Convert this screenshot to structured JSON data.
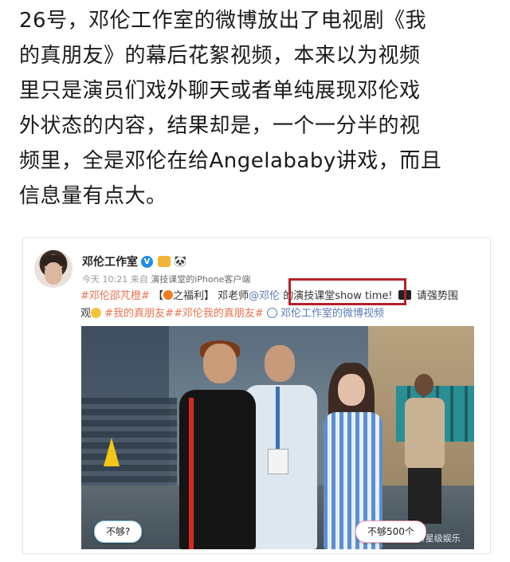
{
  "article": {
    "line1": "26号，邓伦工作室的微博放出了电视剧《我",
    "line2": "的真朋友》的幕后花絮视频，本来以为视频",
    "line3": "里只是演员们戏外聊天或者单纯展现邓伦戏",
    "line4": "外状态的内容，结果却是，一个一分半的视",
    "line5": "频里，全是邓伦在给Angelababy讲戏，而且",
    "line6": "信息量有点大。"
  },
  "post": {
    "username": "邓伦工作室",
    "verified_mark": "V",
    "panda_badge": "🐼",
    "time": "今天 10:21",
    "from_prefix": "来自",
    "source": "演技课堂的iPhone客户端",
    "text": {
      "tag1": "#邓伦邵芃橙#",
      "bracket_open": "【",
      "welfare": "之福利】",
      "teacher": "邓老师",
      "mention": "@邓伦",
      "de": " 的",
      "course": "演技课堂show time!",
      "watch": " 请强势围",
      "line2_start": "观",
      "tags2": "#我的真朋友##邓伦我的真朋友#",
      "video_link": "邓伦工作室的微博视频"
    },
    "icons": {
      "orange": "orange-emoji-icon",
      "clapper": "clapper-board-icon",
      "scared_face": "scared-face-icon",
      "play": "play-circle-icon"
    },
    "highlight_color": "#b4222b"
  },
  "video": {
    "subtitle_left": "不够?",
    "subtitle_right": "不够500个",
    "watermark": "百家号/星级娱乐"
  },
  "colors": {
    "tag": "#eb7350",
    "link": "#5a7bb8",
    "verified": "#1b8ee6"
  }
}
